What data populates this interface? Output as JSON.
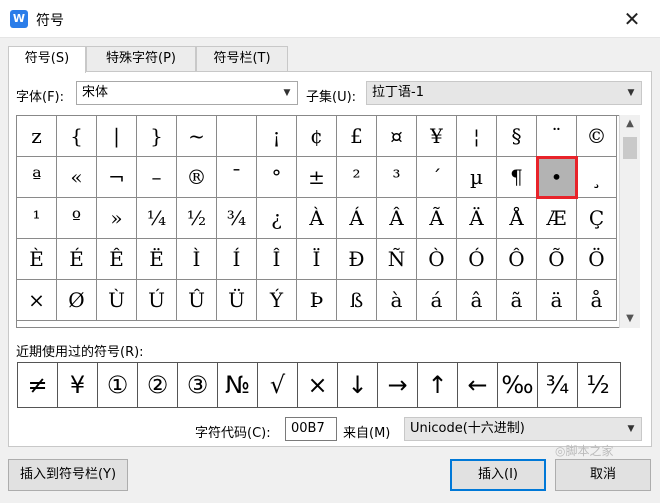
{
  "window": {
    "title": "符号",
    "icon_text": "W",
    "close_glyph": "✕"
  },
  "tabs": [
    {
      "label": "符号(S)",
      "active": true
    },
    {
      "label": "特殊字符(P)",
      "active": false
    },
    {
      "label": "符号栏(T)",
      "active": false
    }
  ],
  "font": {
    "label": "字体(F):",
    "value": "宋体"
  },
  "subset": {
    "label": "子集(U):",
    "value": "拉丁语-1"
  },
  "symbol_grid": [
    [
      "z",
      "{",
      "|",
      "}",
      "~",
      " ",
      "¡",
      "¢",
      "£",
      "¤",
      "¥",
      "¦",
      "§",
      "¨",
      "©"
    ],
    [
      "ª",
      "«",
      "¬",
      "–",
      "®",
      "¯",
      "°",
      "±",
      "²",
      "³",
      "´",
      "µ",
      "¶",
      "•",
      "¸"
    ],
    [
      "¹",
      "º",
      "»",
      "¼",
      "½",
      "¾",
      "¿",
      "À",
      "Á",
      "Â",
      "Ã",
      "Ä",
      "Å",
      "Æ",
      "Ç"
    ],
    [
      "È",
      "É",
      "Ê",
      "Ë",
      "Ì",
      "Í",
      "Î",
      "Ï",
      "Ð",
      "Ñ",
      "Ò",
      "Ó",
      "Ô",
      "Õ",
      "Ö"
    ],
    [
      "×",
      "Ø",
      "Ù",
      "Ú",
      "Û",
      "Ü",
      "Ý",
      "Þ",
      "ß",
      "à",
      "á",
      "â",
      "ã",
      "ä",
      "å"
    ]
  ],
  "selected_cell": {
    "row": 1,
    "col": 13
  },
  "recent": {
    "label": "近期使用过的符号(R):",
    "items": [
      "≠",
      "¥",
      "①",
      "②",
      "③",
      "№",
      "√",
      "×",
      "↓",
      "→",
      "↑",
      "←",
      "‰",
      "¾",
      "½"
    ]
  },
  "char_code": {
    "label": "字符代码(C):",
    "value": "00B7"
  },
  "from": {
    "label": "来自(M)",
    "value": "Unicode(十六进制)"
  },
  "buttons": {
    "insert_to_bar": "插入到符号栏(Y)",
    "insert": "插入(I)",
    "cancel": "取消"
  },
  "watermark": "◎脚本之家",
  "colors": {
    "selection_border": "#e8232a",
    "selection_fill": "#b3b3b3",
    "app_icon": "#2b7de9"
  }
}
